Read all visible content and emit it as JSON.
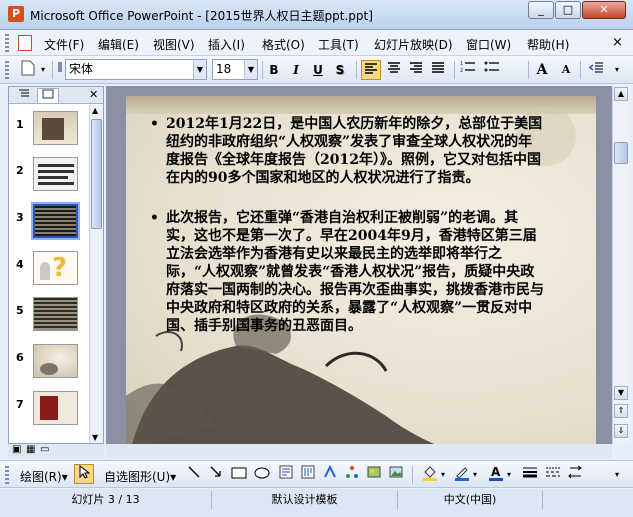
{
  "window": {
    "title": "Microsoft Office PowerPoint - [2015世界人权日主题ppt.ppt]",
    "min": "_",
    "max": "□",
    "close": "✕"
  },
  "menu": {
    "items": [
      "文件(F)",
      "编辑(E)",
      "视图(V)",
      "插入(I)",
      "格式(O)",
      "工具(T)",
      "幻灯片放映(D)",
      "窗口(W)",
      "帮助(H)"
    ],
    "close": "×"
  },
  "toolbar": {
    "font_name": "宋体",
    "font_size": "18",
    "bold": "B",
    "italic": "I",
    "underline": "U",
    "shadow": "S",
    "grow_font": "A",
    "shrink_font": "A"
  },
  "thumbnails": {
    "numbers": [
      "1",
      "2",
      "3",
      "4",
      "5",
      "6",
      "7"
    ],
    "selected": 3,
    "colors": [
      "#5a4a3c",
      "#f2f2f2",
      "#1a1a1a",
      "#f6e7b5",
      "#2b2b2b",
      "#d9cfba",
      "#f1e9dc"
    ]
  },
  "slide": {
    "bullets": [
      "2012年1月22日，是中国人农历新年的除夕，总部位于美国纽约的非政府组织“人权观察”发表了审查全球人权状况的年度报告《全球年度报告（2012年）》。照例，它又对包括中国在内的90多个国家和地区的人权状况进行了指责。",
      "此次报告，它还重弹“香港自治权利正被削弱”的老调。其实，这也不是第一次了。早在2004年9月，香港特区第三届立法会选举作为香港有史以来最民主的选举即将举行之际，“人权观察”就曾发表“香港人权状况”报告，质疑中央政府落实一国两制的决心。报告再次歪曲事实，挑拨香港市民与中央政府和特区政府的关系，暴露了“人权观察”一贯反对中国、插手别国事务的丑恶面目。"
    ],
    "bullet_char": "•"
  },
  "drawbar": {
    "draw_label": "绘图(R)▾",
    "autoshape_label": "自选图形(U)▾"
  },
  "status": {
    "slide": "幻灯片 3 / 13",
    "design": "默认设计模板",
    "language": "中文(中国)"
  }
}
